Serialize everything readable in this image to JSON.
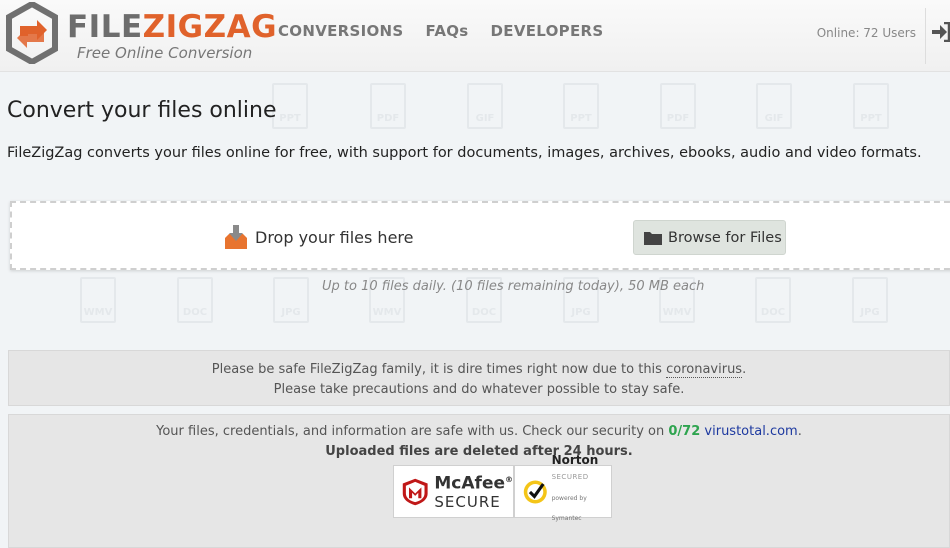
{
  "brand": {
    "name_part1": "FILE",
    "name_part2": "ZIGZAG",
    "tagline": "Free Online Conversion",
    "color_gray": "#6d6d6d",
    "color_orange": "#e0622b"
  },
  "nav": {
    "items": [
      "CONVERSIONS",
      "FAQs",
      "DEVELOPERS"
    ]
  },
  "header": {
    "online_text": "Online: 72 Users",
    "login_icon": "sign-in-icon"
  },
  "background_icons": [
    "PPT",
    "PDF",
    "GIF",
    "PPT",
    "PDF",
    "GIF",
    "PPT",
    "WMV",
    "DOC",
    "JPG",
    "WMV",
    "DOC",
    "JPG",
    "WMV",
    "DOC",
    "JPG"
  ],
  "main": {
    "title": "Convert your files online",
    "description": "FileZigZag converts your files online for free, with support for documents, images, archives, ebooks, audio and video formats."
  },
  "dropzone": {
    "label": "Drop your files here",
    "browse_label": "Browse for Files",
    "drop_icon": "download-icon",
    "browse_icon": "folder-icon",
    "limits": "Up to 10 files daily. (10 files remaining today), 50 MB each"
  },
  "notice_corona": {
    "line1_prefix": "Please be safe FileZigZag family, it is dire times right now due to this",
    "line1_link": "coronavirus",
    "line1_suffix": ".",
    "line2": "Please take precautions and do whatever possible to stay safe."
  },
  "notice_security": {
    "line1_prefix": "Your files, credentials, and information are safe with us. Check our security on",
    "count": "0/72",
    "link": "virustotal.com",
    "line1_suffix": ".",
    "line2": "Uploaded files are deleted after 24 hours.",
    "mcafee_name": "McAfee",
    "mcafee_reg": "®",
    "mcafee_secure": "SECURE",
    "norton_name": "Norton",
    "norton_secured": "SECURED",
    "norton_powered": "powered by Symantec",
    "color_count": "#2ea44f",
    "color_link": "#1e3aa0"
  }
}
